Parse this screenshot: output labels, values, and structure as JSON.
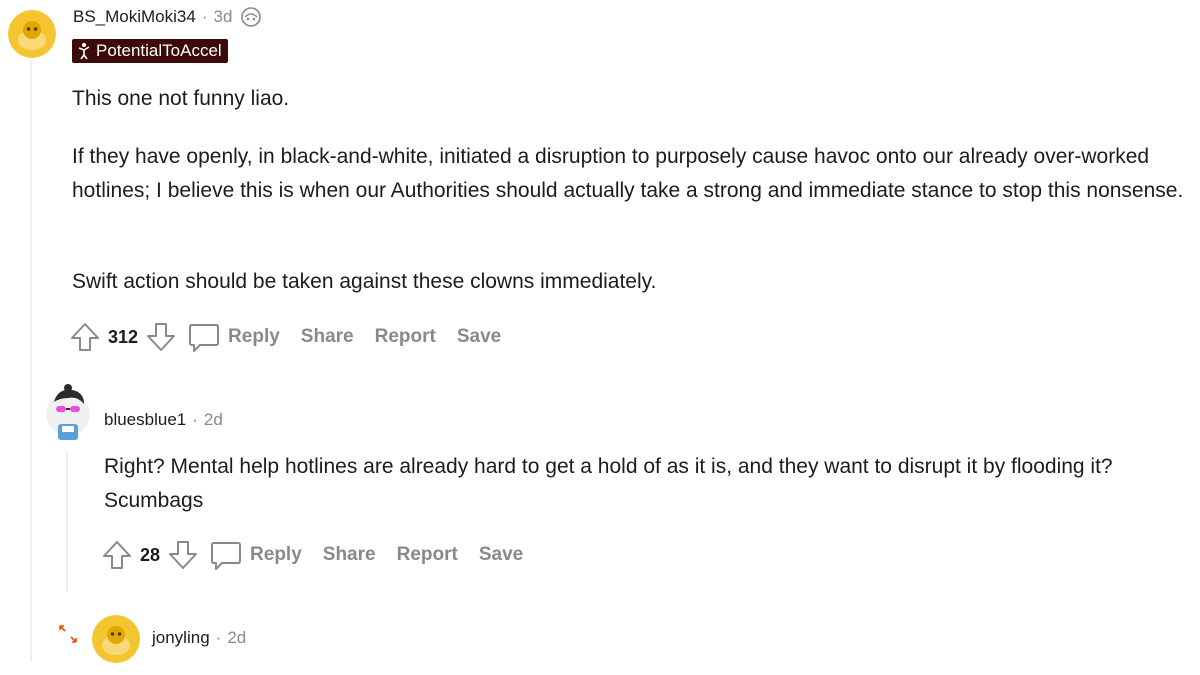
{
  "comments": [
    {
      "username": "BS_MokiMoki34",
      "separator": "·",
      "time": "3d",
      "flair": "PotentialToAccel",
      "paragraphs": [
        "This one not funny liao.",
        "If they have openly, in black-and-white, initiated a disruption to purposely cause havoc onto our already over-worked hotlines; I believe this is when our Authorities should actually take a strong and immediate stance to stop this nonsense.",
        "Swift action should be taken against these clowns immediately."
      ],
      "votes": "312",
      "actions": {
        "reply": "Reply",
        "share": "Share",
        "report": "Report",
        "save": "Save"
      }
    },
    {
      "username": "bluesblue1",
      "separator": "·",
      "time": "2d",
      "paragraphs": [
        "Right? Mental help hotlines are already hard to get a hold of as it is, and they want to disrupt it by flooding it? Scumbags"
      ],
      "votes": "28",
      "actions": {
        "reply": "Reply",
        "share": "Share",
        "report": "Report",
        "save": "Save"
      }
    },
    {
      "username": "jonyling",
      "separator": "·",
      "time": "2d"
    }
  ],
  "colors": {
    "avatar_yellow": "#f5c531",
    "flair_bg": "#3d0a0a",
    "muted": "#878a8c",
    "thread_line": "#edeff1",
    "expand_icon": "#ff4500"
  },
  "icons": [
    "snoo-avatar",
    "award-icon",
    "flair-icon",
    "upvote-icon",
    "downvote-icon",
    "comment-icon",
    "expand-icon"
  ]
}
